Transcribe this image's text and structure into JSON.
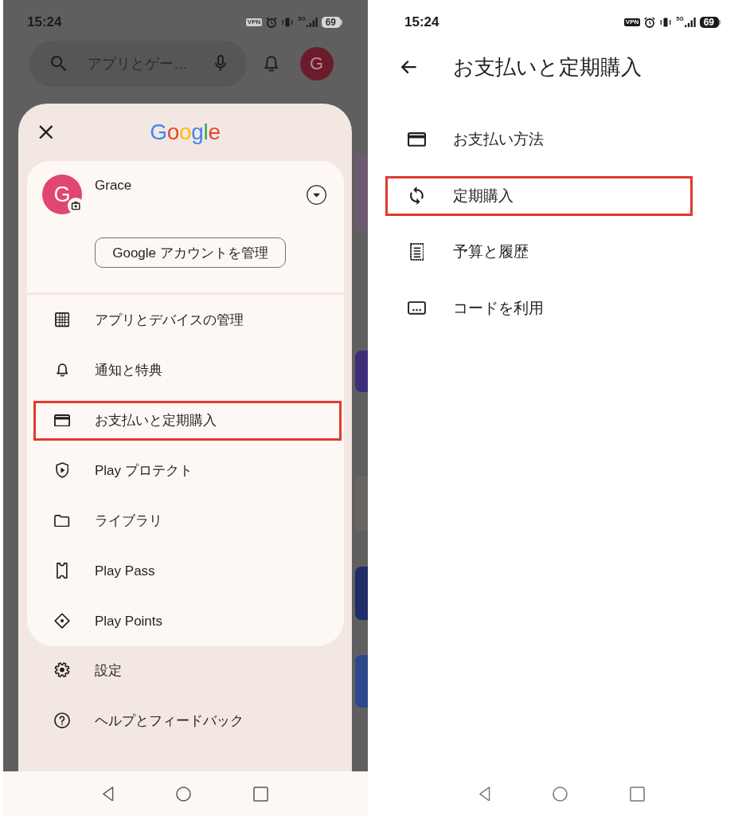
{
  "left_screen": {
    "status_bar": {
      "time": "15:24",
      "vpn": "VPN",
      "network": "5G",
      "battery": "69"
    },
    "search": {
      "placeholder": "アプリとゲー…"
    },
    "avatar_initial": "G",
    "drawer": {
      "logo": "Google",
      "account": {
        "initial": "G",
        "name": "Grace"
      },
      "manage_button": "Google アカウントを管理",
      "menu": [
        {
          "label": "アプリとデバイスの管理",
          "highlighted": false
        },
        {
          "label": "通知と特典",
          "highlighted": false
        },
        {
          "label": "お支払いと定期購入",
          "highlighted": true
        },
        {
          "label": "Play プロテクト",
          "highlighted": false
        },
        {
          "label": "ライブラリ",
          "highlighted": false
        },
        {
          "label": "Play Pass",
          "highlighted": false
        },
        {
          "label": "Play Points",
          "highlighted": false
        }
      ],
      "footer_menu": [
        {
          "label": "設定"
        },
        {
          "label": "ヘルプとフィードバック"
        }
      ]
    }
  },
  "right_screen": {
    "status_bar": {
      "time": "15:24",
      "vpn": "VPN",
      "network": "5G",
      "battery": "69"
    },
    "title": "お支払いと定期購入",
    "menu": [
      {
        "label": "お支払い方法",
        "highlighted": false
      },
      {
        "label": "定期購入",
        "highlighted": true
      },
      {
        "label": "予算と履歴",
        "highlighted": false
      },
      {
        "label": "コードを利用",
        "highlighted": false
      }
    ]
  }
}
